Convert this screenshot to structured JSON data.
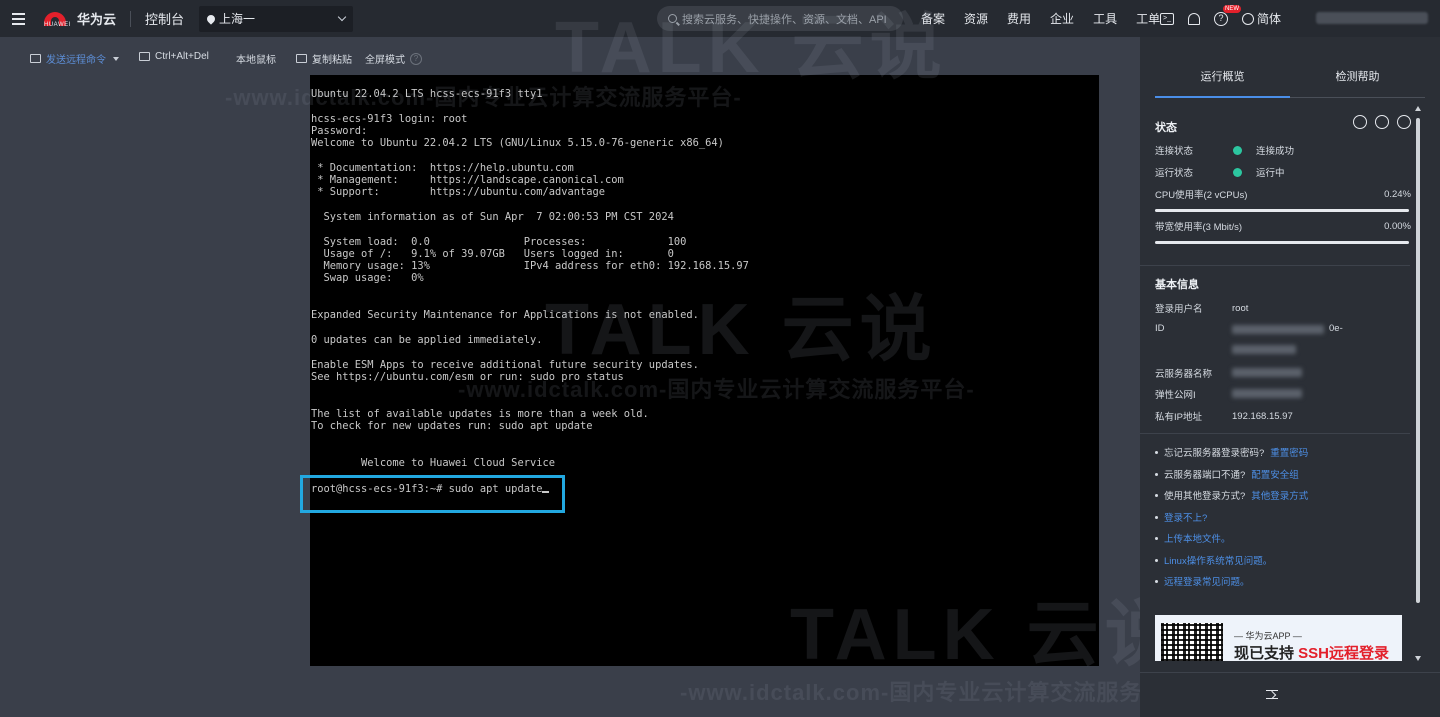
{
  "topbar": {
    "brand": "华为云",
    "logo_text": "HUAWEI",
    "console": "控制台",
    "region": "上海一",
    "search_placeholder": "搜索云服务、快捷操作、资源、文档、API",
    "nav_links": [
      "备案",
      "资源",
      "费用",
      "企业",
      "工具",
      "工单"
    ],
    "new_badge": "NEW",
    "language": "简体"
  },
  "toolbar": {
    "send_command": "发送远程命令",
    "ctrl_alt_del": "Ctrl+Alt+Del",
    "local_mouse": "本地鼠标",
    "copy_paste": "复制粘贴",
    "fullscreen": "全屏模式"
  },
  "terminal": {
    "lines": [
      "Ubuntu 22.04.2 LTS hcss-ecs-91f3 tty1",
      "",
      "hcss-ecs-91f3 login: root",
      "Password:",
      "Welcome to Ubuntu 22.04.2 LTS (GNU/Linux 5.15.0-76-generic x86_64)",
      "",
      " * Documentation:  https://help.ubuntu.com",
      " * Management:     https://landscape.canonical.com",
      " * Support:        https://ubuntu.com/advantage",
      "",
      "  System information as of Sun Apr  7 02:00:53 PM CST 2024",
      "",
      "  System load:  0.0               Processes:             100",
      "  Usage of /:   9.1% of 39.07GB   Users logged in:       0",
      "  Memory usage: 13%               IPv4 address for eth0: 192.168.15.97",
      "  Swap usage:   0%",
      "",
      "",
      "Expanded Security Maintenance for Applications is not enabled.",
      "",
      "0 updates can be applied immediately.",
      "",
      "Enable ESM Apps to receive additional future security updates.",
      "See https://ubuntu.com/esm or run: sudo pro status",
      "",
      "",
      "The list of available updates is more than a week old.",
      "To check for new updates run: sudo apt update",
      "",
      "",
      "        Welcome to Huawei Cloud Service"
    ],
    "command_line": "root@hcss-ecs-91f3:~# sudo apt update"
  },
  "watermark": {
    "brand": "TALK 云说",
    "line": "-www.idctalk.com-国内专业云计算交流服务平台-"
  },
  "panel": {
    "tabs": [
      "运行概览",
      "检测帮助"
    ],
    "status": {
      "title": "状态",
      "connection_label": "连接状态",
      "connection_value": "连接成功",
      "run_label": "运行状态",
      "run_value": "运行中",
      "cpu_label": "CPU使用率(2 vCPUs)",
      "cpu_value": "0.24%",
      "cpu_fraction": 0.0024,
      "bw_label": "带宽使用率(3 Mbit/s)",
      "bw_value": "0.00%",
      "bw_fraction": 0,
      "status_color": "#2cc6a0"
    },
    "basic": {
      "title": "基本信息",
      "login_user_label": "登录用户名",
      "login_user_value": "root",
      "id_label": "ID",
      "id_partial": "0e-",
      "server_name_label": "云服务器名称",
      "eip_label": "弹性公网I",
      "private_ip_label": "私有IP地址",
      "private_ip_value": "192.168.15.97"
    },
    "help": [
      {
        "text": "忘记云服务器登录密码?",
        "link": "重置密码"
      },
      {
        "text": "云服务器端口不通?",
        "link": "配置安全组"
      },
      {
        "text": "使用其他登录方式?",
        "link": "其他登录方式"
      },
      {
        "text": "",
        "link": "登录不上?"
      },
      {
        "text": "",
        "link": "上传本地文件。"
      },
      {
        "text": "",
        "link": "Linux操作系统常见问题。"
      },
      {
        "text": "",
        "link": "远程登录常见问题。"
      }
    ],
    "banner": {
      "line1": "— 华为云APP —",
      "line2_prefix": "现已支持 ",
      "line2_highlight": "SSH远程登录"
    }
  }
}
